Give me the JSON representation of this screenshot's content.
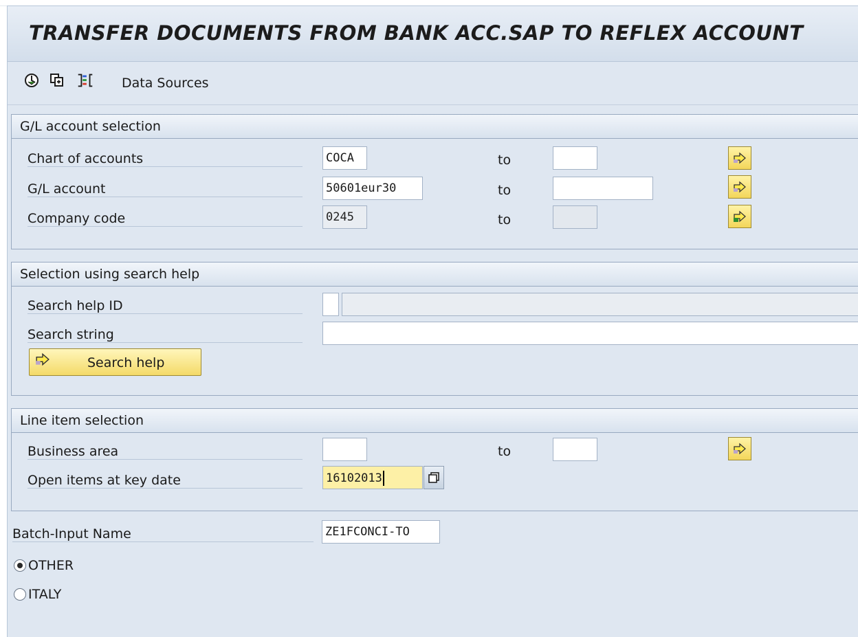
{
  "header": {
    "title": "TRANSFER DOCUMENTS FROM BANK ACC.SAP TO REFLEX ACCOUNT"
  },
  "toolbar": {
    "items": [
      {
        "icon": "execute-icon"
      },
      {
        "icon": "copy-variant-icon"
      },
      {
        "icon": "selection-options-icon"
      }
    ],
    "data_sources_label": "Data Sources"
  },
  "gl_selection": {
    "title": "G/L account selection",
    "to_label": "to",
    "rows": [
      {
        "label": "Chart of accounts",
        "from": "COCA",
        "to": ""
      },
      {
        "label": "G/L account",
        "from": "50601eur30",
        "to": ""
      },
      {
        "label": "Company code",
        "from": "0245",
        "to": ""
      }
    ]
  },
  "search_help": {
    "title": "Selection using search help",
    "id_label": "Search help ID",
    "id_value": "",
    "id_description": "",
    "string_label": "Search string",
    "string_value": "",
    "button_label": "Search help"
  },
  "line_items": {
    "title": "Line item selection",
    "to_label": "to",
    "business_area_label": "Business area",
    "business_area_from": "",
    "business_area_to": "",
    "key_date_label": "Open items at key date",
    "key_date_value": "16102013"
  },
  "batch": {
    "label": "Batch-Input Name",
    "value": "ZE1FCONCI-TO"
  },
  "options": [
    {
      "label": "OTHER",
      "selected": true
    },
    {
      "label": "ITALY",
      "selected": false
    }
  ],
  "colors": {
    "accent_button": "#f3d65a",
    "highlight_field": "#fdf0a6",
    "background": "#dfe7f1"
  }
}
